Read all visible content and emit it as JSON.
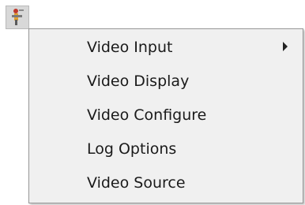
{
  "app": {
    "icon": "tool-app-icon"
  },
  "menu": {
    "items": [
      {
        "label": "Video Input",
        "has_submenu": true
      },
      {
        "label": "Video Display",
        "has_submenu": false
      },
      {
        "label": "Video Configure",
        "has_submenu": false
      },
      {
        "label": "Log Options",
        "has_submenu": false
      },
      {
        "label": "Video Source",
        "has_submenu": false
      }
    ]
  },
  "colors": {
    "menu_background": "#f0f0f0",
    "menu_border": "#979797",
    "text": "#1a1a1a"
  }
}
